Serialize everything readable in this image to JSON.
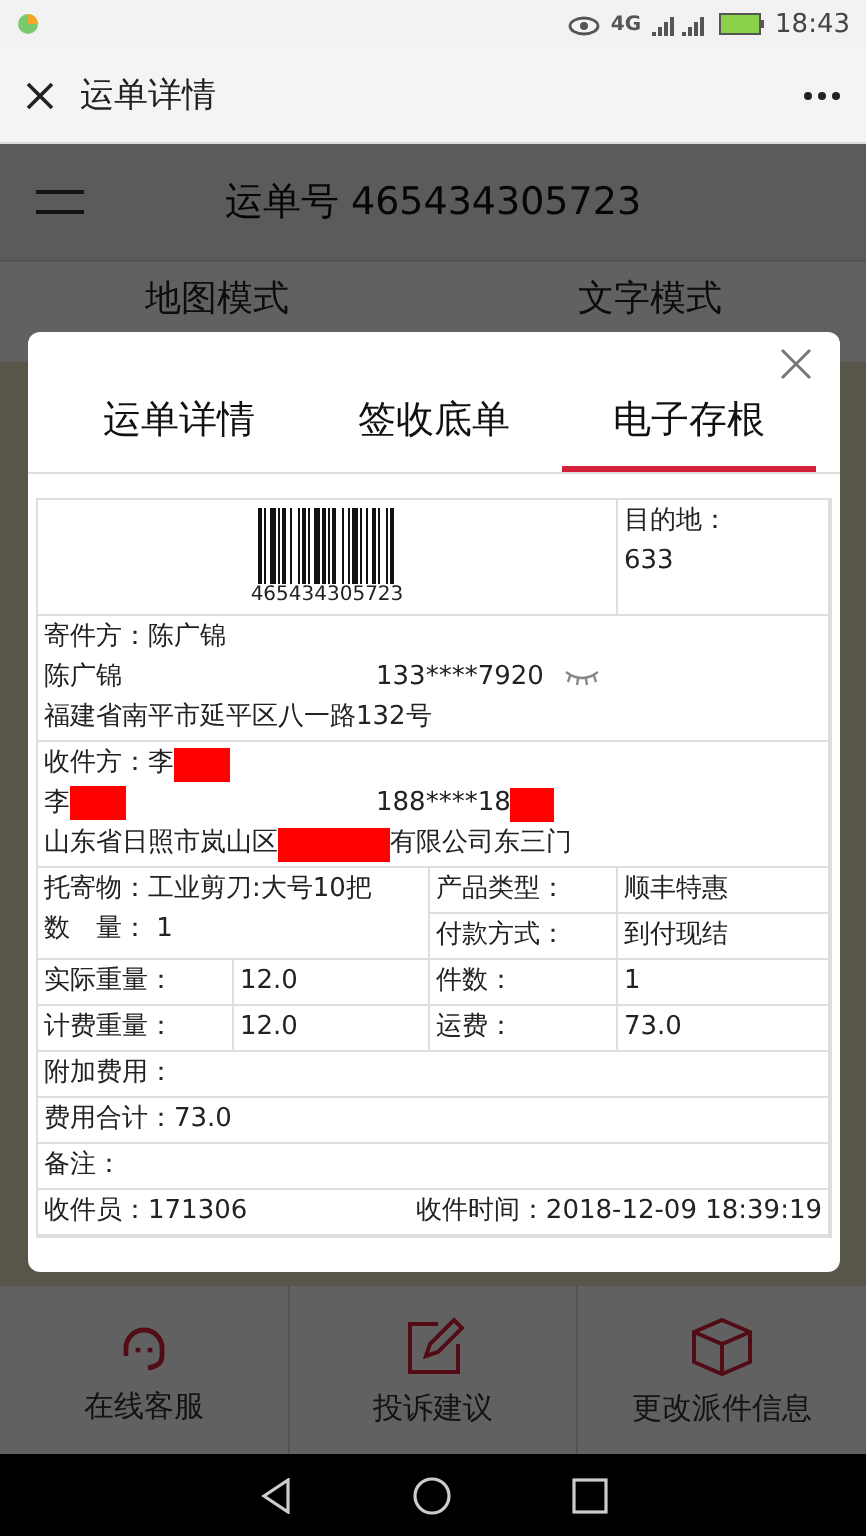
{
  "status_bar": {
    "network": "4G",
    "time": "18:43"
  },
  "app_bar": {
    "title": "运单详情"
  },
  "page": {
    "title": "运单号 465434305723",
    "modes": [
      {
        "label": "地图模式"
      },
      {
        "label": "文字模式"
      }
    ],
    "actions": [
      {
        "kind": "headset",
        "label": "在线客服"
      },
      {
        "kind": "edit",
        "label": "投诉建议"
      },
      {
        "kind": "box",
        "label": "更改派件信息"
      }
    ]
  },
  "dialog": {
    "tabs": [
      {
        "label": "运单详情",
        "selected": false
      },
      {
        "label": "签收底单",
        "selected": false
      },
      {
        "label": "电子存根",
        "selected": true
      }
    ],
    "barcode_number": "465434305723",
    "destination_label": "目的地：",
    "destination": "633",
    "sender": {
      "heading": [
        {
          "kind": "text",
          "text": "寄件方：陈广锦"
        }
      ],
      "name": [
        {
          "kind": "text",
          "text": "陈广锦"
        }
      ],
      "phone": [
        {
          "kind": "text",
          "text": "133****7920"
        }
      ],
      "address": [
        {
          "kind": "text",
          "text": "福建省南平市延平区八一路132号"
        }
      ],
      "masked": true
    },
    "receiver": {
      "heading": [
        {
          "kind": "text",
          "text": "收件方：李"
        },
        {
          "kind": "redaction"
        }
      ],
      "name": [
        {
          "kind": "text",
          "text": "李"
        },
        {
          "kind": "redaction"
        }
      ],
      "phone": [
        {
          "kind": "text",
          "text": "188****18"
        },
        {
          "kind": "redaction"
        }
      ],
      "address": [
        {
          "kind": "text",
          "text": "山东省日照市岚山区"
        },
        {
          "kind": "redaction"
        },
        {
          "kind": "text",
          "text": "有限公司东三门"
        }
      ]
    },
    "goods": [
      "托寄物：工业剪刀:大号10把",
      "数　量：  1"
    ],
    "terms": [
      {
        "label": "产品类型：",
        "value": "顺丰特惠"
      },
      {
        "label": "付款方式：",
        "value": "到付现结"
      }
    ],
    "grid_rows": [
      [
        "实际重量：",
        "12.0",
        "件数：",
        "1"
      ],
      [
        "计费重量：",
        "12.0",
        "运费：",
        "73.0"
      ]
    ],
    "notes": [
      "附加费用：",
      "费用合计：73.0",
      "备注："
    ],
    "footer": {
      "collector": "收件员：171306",
      "time": "收件时间：2018-12-09 18:39:19"
    }
  }
}
